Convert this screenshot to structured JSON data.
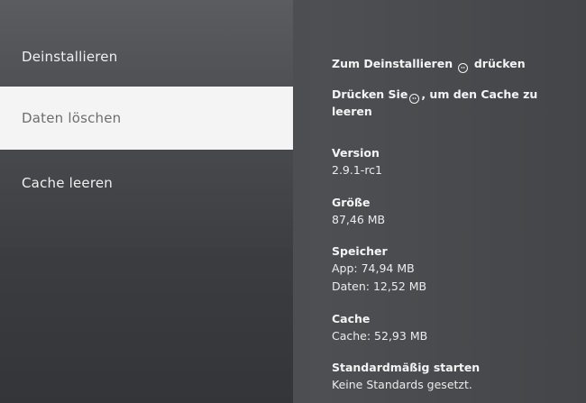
{
  "menu": {
    "items": [
      {
        "label": "Deinstallieren"
      },
      {
        "label": "Daten löschen"
      },
      {
        "label": "Cache leeren"
      }
    ]
  },
  "hints": {
    "uninstall_before": "Zum Deinstallieren",
    "uninstall_after": "drücken",
    "cache_before": "Drücken Sie",
    "cache_after": ", um den Cache zu leeren",
    "icon": "options-button-icon"
  },
  "info": {
    "version_label": "Version",
    "version_value": "2.9.1-rc1",
    "size_label": "Größe",
    "size_value": "87,46 MB",
    "storage_label": "Speicher",
    "storage_app": "App: 74,94 MB",
    "storage_data": "Daten: 12,52 MB",
    "cache_label": "Cache",
    "cache_value": "Cache: 52,93 MB",
    "default_label": "Standardmäßig starten",
    "default_value": "Keine Standards gesetzt."
  },
  "colors": {
    "selected_bg": "#f4f4f4",
    "selected_text": "#6e6e70",
    "text": "#f2f2f2"
  }
}
